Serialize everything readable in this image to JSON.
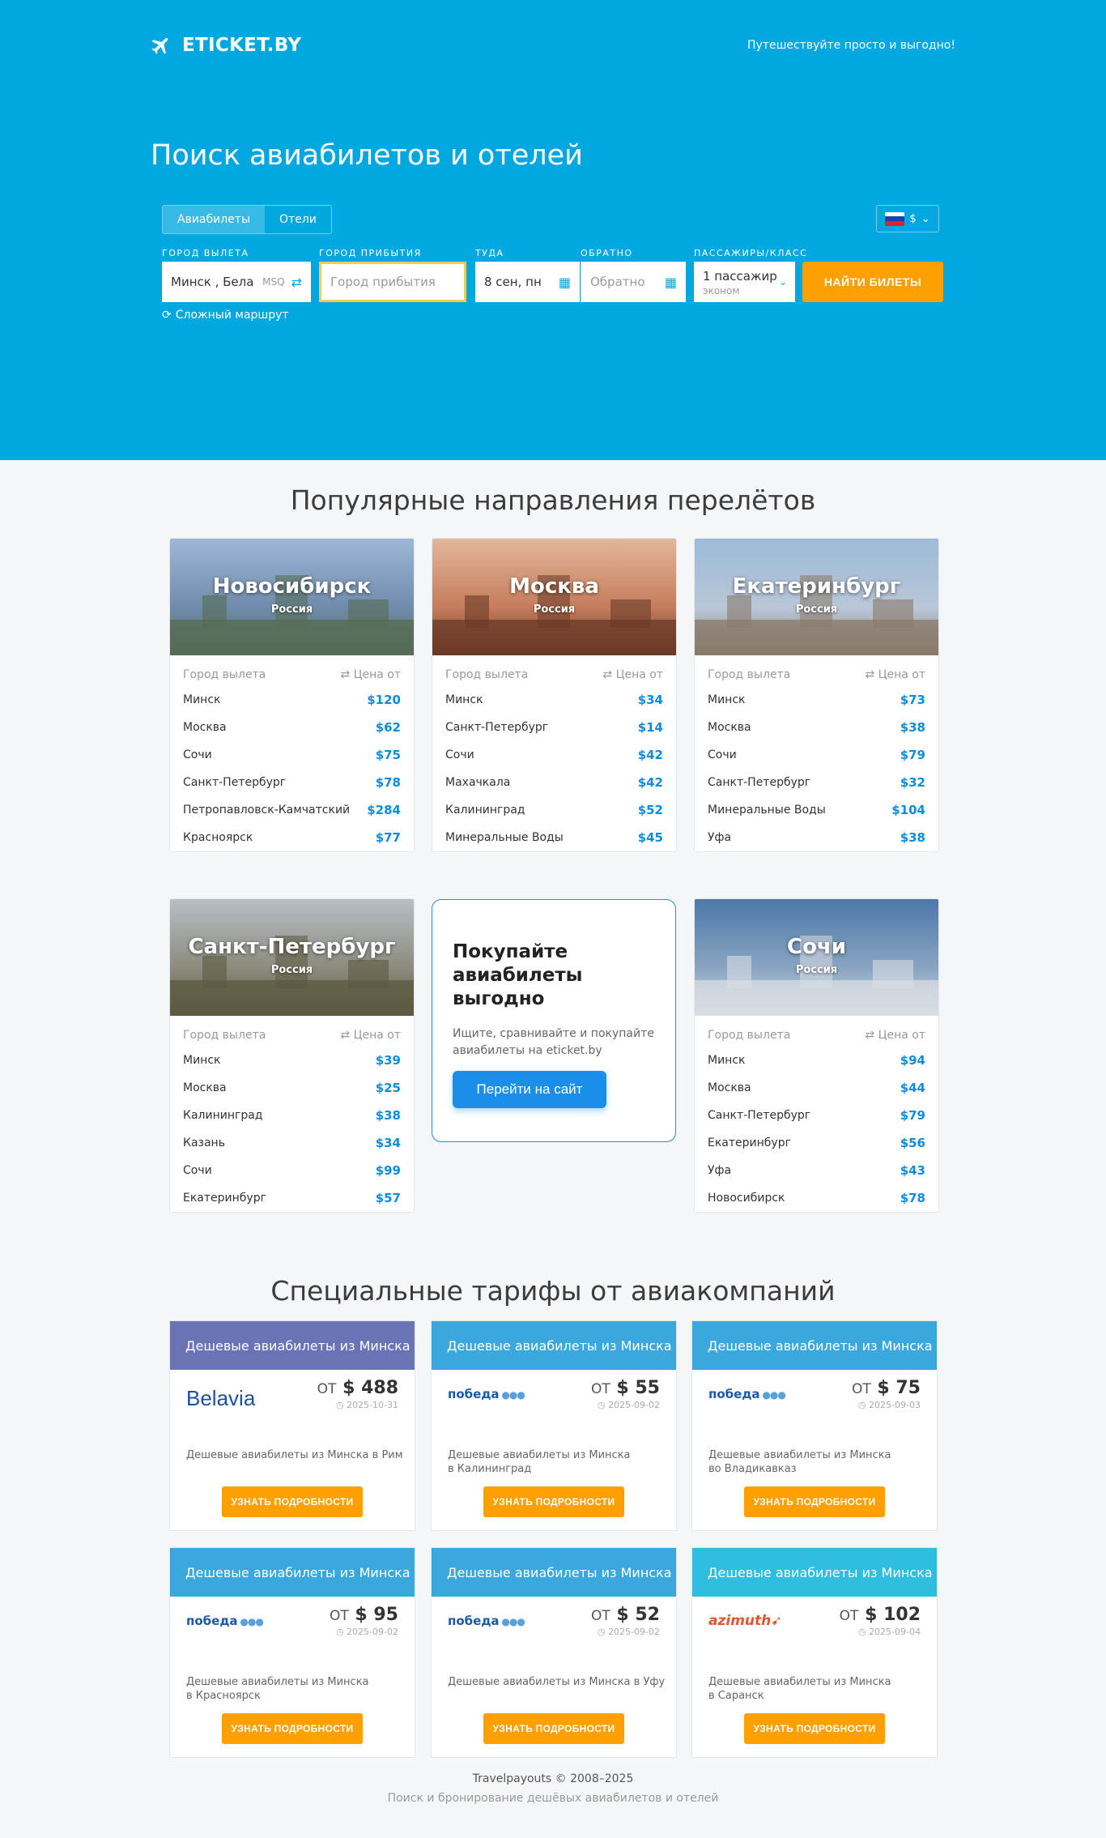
{
  "header": {
    "logo_text": "ETICKET.BY",
    "tagline": "Путешествуйте просто и выгодно!",
    "hero_title": "Поиск авиабилетов и отелей"
  },
  "search": {
    "tabs": [
      {
        "label": "Авиабилеты",
        "active": true
      },
      {
        "label": "Отели",
        "active": false
      }
    ],
    "currency": "$",
    "labels": {
      "from": "Город вылета",
      "to": "Город прибытия",
      "depart": "Туда",
      "return": "Обратно",
      "pax": "Пассажиры/класс"
    },
    "from_value": "Минск , Беларусь",
    "from_iata": "MSQ",
    "to_placeholder": "Город прибытия",
    "depart_value": "8 сен, пн",
    "return_placeholder": "Обратно",
    "pax_value": "1 пассажир",
    "pax_class": "эконом",
    "submit": "НАЙТИ БИЛЕТЫ",
    "complex_route": "Сложный маршрут"
  },
  "popular": {
    "title": "Популярные направления перелётов",
    "col_from": "Город вылета",
    "col_price": "Цена от",
    "cards": [
      {
        "city": "Новосибирск",
        "country": "Россия",
        "rows": [
          [
            "Минск",
            "$120"
          ],
          [
            "Москва",
            "$62"
          ],
          [
            "Сочи",
            "$75"
          ],
          [
            "Санкт-Петербург",
            "$78"
          ],
          [
            "Петропавловск-Камчатский",
            "$284"
          ],
          [
            "Красноярск",
            "$77"
          ]
        ]
      },
      {
        "city": "Москва",
        "country": "Россия",
        "rows": [
          [
            "Минск",
            "$34"
          ],
          [
            "Санкт-Петербург",
            "$14"
          ],
          [
            "Сочи",
            "$42"
          ],
          [
            "Махачкала",
            "$42"
          ],
          [
            "Калининград",
            "$52"
          ],
          [
            "Минеральные Воды",
            "$45"
          ]
        ]
      },
      {
        "city": "Екатеринбург",
        "country": "Россия",
        "rows": [
          [
            "Минск",
            "$73"
          ],
          [
            "Москва",
            "$38"
          ],
          [
            "Сочи",
            "$79"
          ],
          [
            "Санкт-Петербург",
            "$32"
          ],
          [
            "Минеральные Воды",
            "$104"
          ],
          [
            "Уфа",
            "$38"
          ]
        ]
      },
      {
        "city": "Санкт-Петербург",
        "country": "Россия",
        "rows": [
          [
            "Минск",
            "$39"
          ],
          [
            "Москва",
            "$25"
          ],
          [
            "Калининград",
            "$38"
          ],
          [
            "Казань",
            "$34"
          ],
          [
            "Сочи",
            "$99"
          ],
          [
            "Екатеринбург",
            "$57"
          ]
        ]
      },
      {
        "city": "Сочи",
        "country": "Россия",
        "rows": [
          [
            "Минск",
            "$94"
          ],
          [
            "Москва",
            "$44"
          ],
          [
            "Санкт-Петербург",
            "$79"
          ],
          [
            "Екатеринбург",
            "$56"
          ],
          [
            "Уфа",
            "$43"
          ],
          [
            "Новосибирск",
            "$78"
          ]
        ]
      }
    ],
    "promo": {
      "title": "Покупайте авиабилеты выгодно",
      "text": "Ищите, сравнивайте и покупайте авиабилеты на eticket.by",
      "button": "Перейти на сайт"
    }
  },
  "tariffs": {
    "title": "Специальные тарифы от авиакомпаний",
    "from_word": "ОТ",
    "button": "УЗНАТЬ ПОДРОБНОСТИ",
    "cards": [
      {
        "head": "Дешевые авиабилеты из Минска",
        "color": "#6a73b6",
        "airline": "Belavia",
        "price": "$ 488",
        "date": "2025-10-31",
        "desc": "Дешевые авиабилеты из Минска в Рим"
      },
      {
        "head": "Дешевые авиабилеты из Минска",
        "color": "#3aa8de",
        "airline": "победа",
        "price": "$ 55",
        "date": "2025-09-02",
        "desc": "Дешевые авиабилеты из Минска\nв Калининград"
      },
      {
        "head": "Дешевые авиабилеты из Минска",
        "color": "#3aa8de",
        "airline": "победа",
        "price": "$ 75",
        "date": "2025-09-03",
        "desc": "Дешевые авиабилеты из Минска\nво Владикавказ"
      },
      {
        "head": "Дешевые авиабилеты из Минска",
        "color": "#3aa8de",
        "airline": "победа",
        "price": "$ 95",
        "date": "2025-09-02",
        "desc": "Дешевые авиабилеты из Минска\nв Красноярск"
      },
      {
        "head": "Дешевые авиабилеты из Минска",
        "color": "#3aa8de",
        "airline": "победа",
        "price": "$ 52",
        "date": "2025-09-02",
        "desc": "Дешевые авиабилеты из Минска в Уфу"
      },
      {
        "head": "Дешевые авиабилеты из Минска",
        "color": "#2fbde0",
        "airline": "azimuth",
        "price": "$ 102",
        "date": "2025-09-04",
        "desc": "Дешевые авиабилеты из Минска\nв Саранск"
      }
    ]
  },
  "footer": {
    "copyright": "Travelpayouts © 2008–2025",
    "sub": "Поиск и бронирование дешёвых авиабилетов и отелей"
  }
}
